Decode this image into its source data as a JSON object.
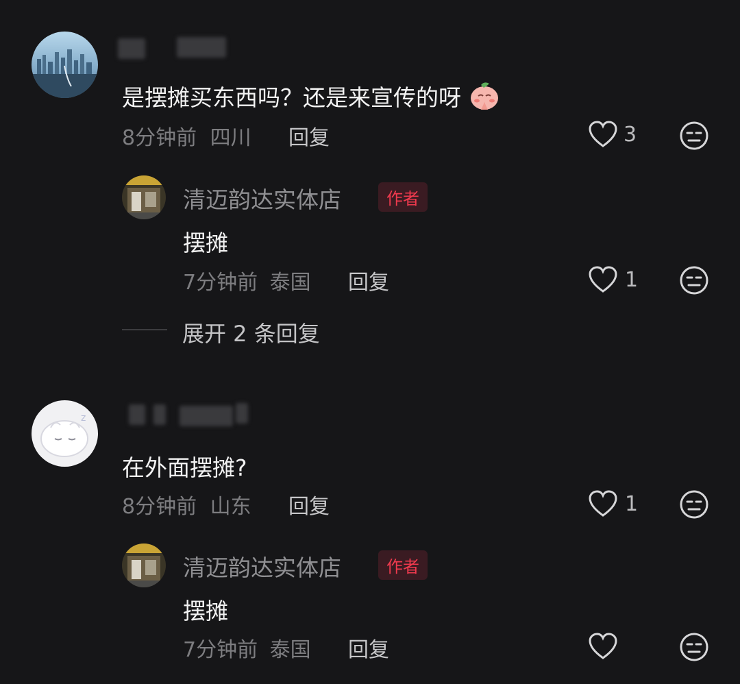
{
  "comments": [
    {
      "text": "是摆摊买东西吗？还是来宣传的呀",
      "time": "8分钟前",
      "location": "四川",
      "reply_label": "回复",
      "likes": "3",
      "reply": {
        "author": "清迈韵达实体店",
        "badge": "作者",
        "text": "摆摊",
        "time": "7分钟前",
        "location": "泰国",
        "reply_label": "回复",
        "likes": "1"
      },
      "expand_label": "展开 2 条回复"
    },
    {
      "text": "在外面摆摊?",
      "time": "8分钟前",
      "location": "山东",
      "reply_label": "回复",
      "likes": "1",
      "reply": {
        "author": "清迈韵达实体店",
        "badge": "作者",
        "text": "摆摊",
        "time": "7分钟前",
        "location": "泰国",
        "reply_label": "回复"
      }
    }
  ],
  "icons": {
    "like": "heart-outline-icon",
    "dislike": "meh-face-icon",
    "emoji": "praying-peach-emoji"
  },
  "colors": {
    "background": "#161618",
    "author_badge": "#f03a4e"
  }
}
